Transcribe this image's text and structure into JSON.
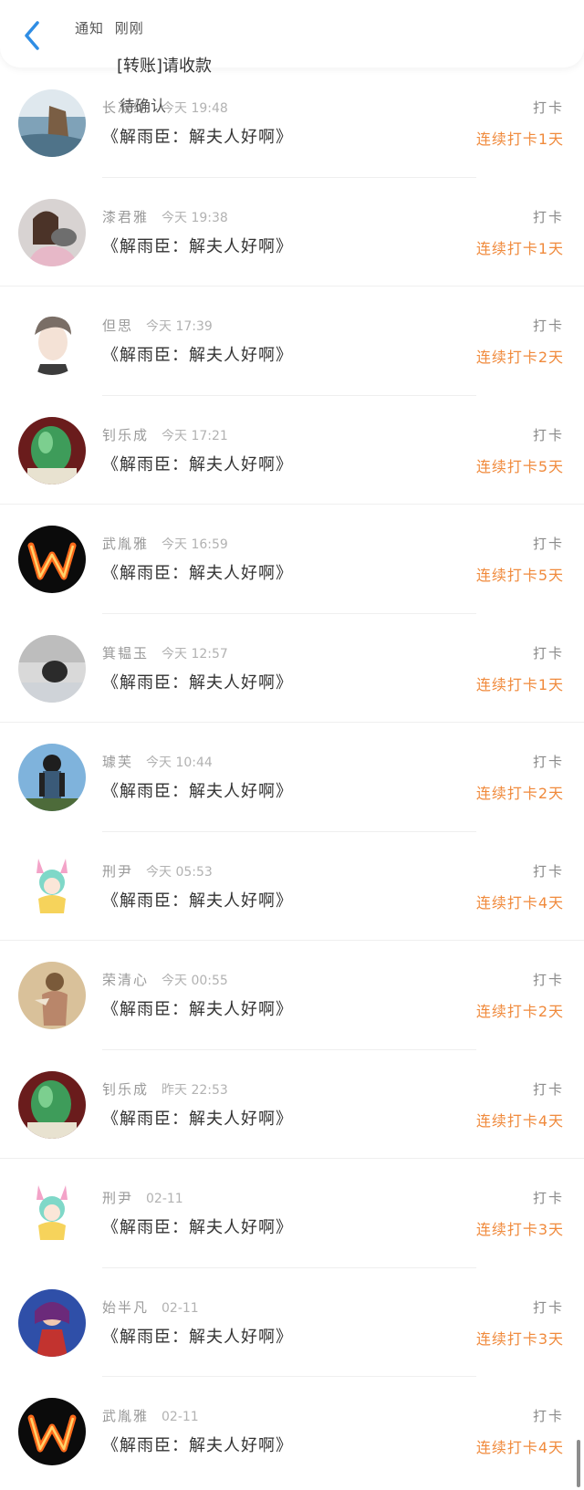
{
  "header": {
    "notice_source": "通知",
    "notice_time": "刚刚",
    "popup_title": "[转账]请收款",
    "popup_status": "待确认"
  },
  "items": [
    {
      "name": "长凝纶",
      "time": "今天 19:48",
      "book": "《解雨臣：解夫人好啊》",
      "tag": "打卡",
      "streak": "连续打卡1天"
    },
    {
      "name": "漆君雅",
      "time": "今天 19:38",
      "book": "《解雨臣：解夫人好啊》",
      "tag": "打卡",
      "streak": "连续打卡1天"
    },
    {
      "name": "但思",
      "time": "今天 17:39",
      "book": "《解雨臣：解夫人好啊》",
      "tag": "打卡",
      "streak": "连续打卡2天"
    },
    {
      "name": "钊乐成",
      "time": "今天 17:21",
      "book": "《解雨臣：解夫人好啊》",
      "tag": "打卡",
      "streak": "连续打卡5天"
    },
    {
      "name": "武胤雅",
      "time": "今天 16:59",
      "book": "《解雨臣：解夫人好啊》",
      "tag": "打卡",
      "streak": "连续打卡5天"
    },
    {
      "name": "箕韫玉",
      "time": "今天 12:57",
      "book": "《解雨臣：解夫人好啊》",
      "tag": "打卡",
      "streak": "连续打卡1天"
    },
    {
      "name": "璩芙",
      "time": "今天 10:44",
      "book": "《解雨臣：解夫人好啊》",
      "tag": "打卡",
      "streak": "连续打卡2天"
    },
    {
      "name": "刑尹",
      "time": "今天 05:53",
      "book": "《解雨臣：解夫人好啊》",
      "tag": "打卡",
      "streak": "连续打卡4天"
    },
    {
      "name": "荣清心",
      "time": "今天 00:55",
      "book": "《解雨臣：解夫人好啊》",
      "tag": "打卡",
      "streak": "连续打卡2天"
    },
    {
      "name": "钊乐成",
      "time": "昨天 22:53",
      "book": "《解雨臣：解夫人好啊》",
      "tag": "打卡",
      "streak": "连续打卡4天"
    },
    {
      "name": "刑尹",
      "time": "02-11",
      "book": "《解雨臣：解夫人好啊》",
      "tag": "打卡",
      "streak": "连续打卡3天"
    },
    {
      "name": "始半凡",
      "time": "02-11",
      "book": "《解雨臣：解夫人好啊》",
      "tag": "打卡",
      "streak": "连续打卡3天"
    },
    {
      "name": "武胤雅",
      "time": "02-11",
      "book": "《解雨臣：解夫人好啊》",
      "tag": "打卡",
      "streak": "连续打卡4天"
    }
  ],
  "colors": {
    "accent": "#2f8de4",
    "streak": "#f08a3c",
    "name": "#9a9a9a",
    "title": "#333333"
  }
}
